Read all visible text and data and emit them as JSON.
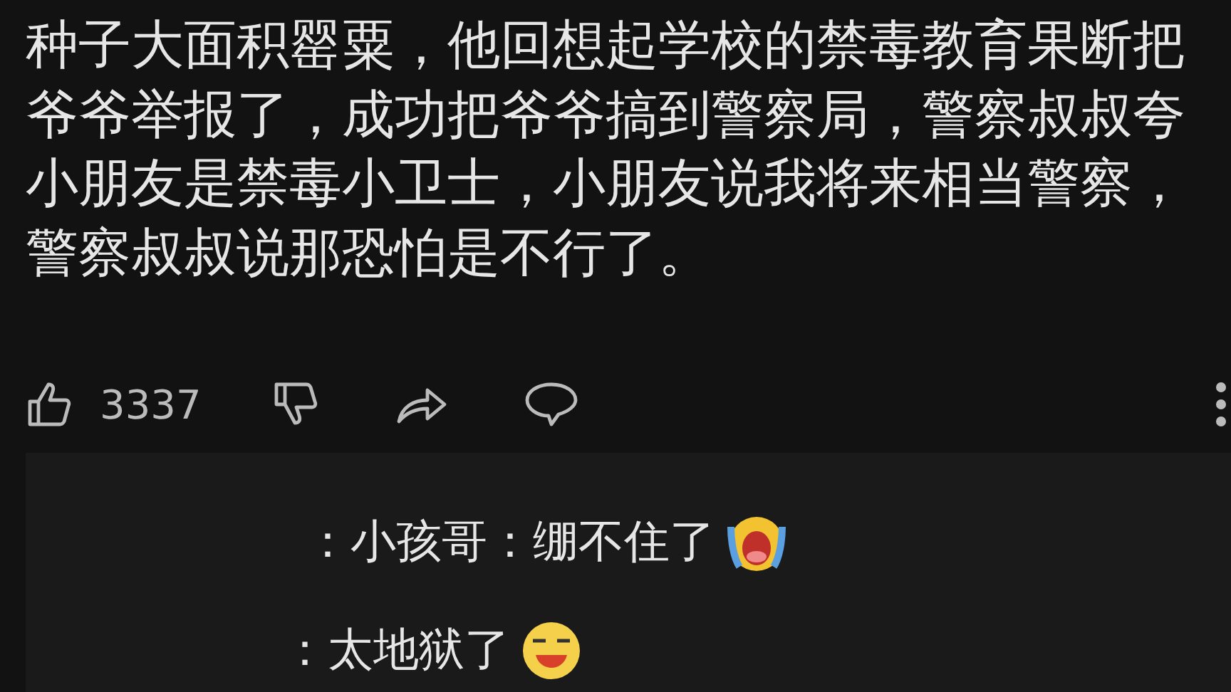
{
  "comment": {
    "text": "种子大面积罂粟，他回想起学校的禁毒教育果断把爷爷举报了，成功把爷爷搞到警察局，警察叔叔夸小朋友是禁毒小卫士，小朋友说我将来相当警察，警察叔叔说那恐怕是不行了。",
    "likes": "3337"
  },
  "replies": [
    {
      "text": "：小孩哥：绷不住了",
      "kind": "crying"
    },
    {
      "text": "：太地狱了",
      "kind": "laughing"
    }
  ]
}
